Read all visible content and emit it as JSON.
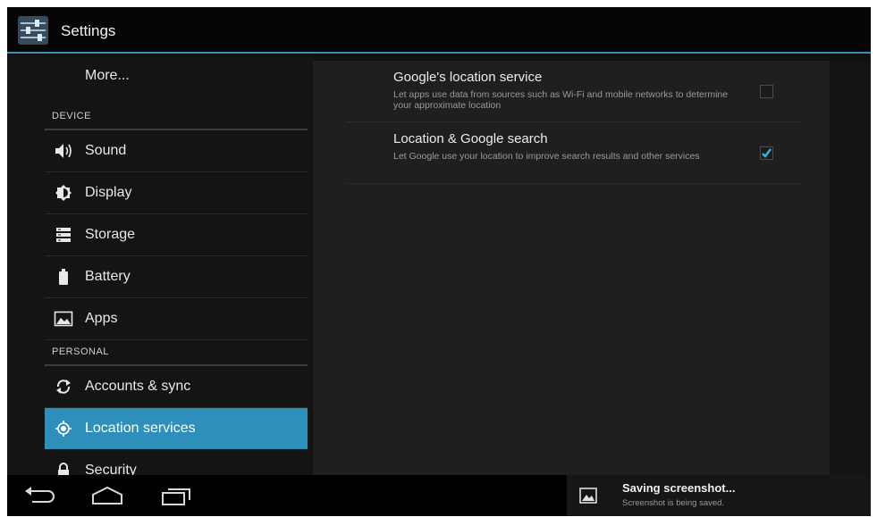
{
  "app": {
    "title": "Settings",
    "icon": "settings-sliders-icon",
    "accent_color": "#3a8fb5"
  },
  "sidebar": {
    "more_label": "More...",
    "device_header": "DEVICE",
    "device_items": [
      {
        "label": "Sound",
        "icon": "speaker-icon"
      },
      {
        "label": "Display",
        "icon": "brightness-icon"
      },
      {
        "label": "Storage",
        "icon": "storage-icon"
      },
      {
        "label": "Battery",
        "icon": "battery-icon"
      },
      {
        "label": "Apps",
        "icon": "apps-icon"
      }
    ],
    "personal_header": "PERSONAL",
    "personal_items": [
      {
        "label": "Accounts & sync",
        "icon": "sync-icon"
      },
      {
        "label": "Location services",
        "icon": "location-icon",
        "selected": true
      },
      {
        "label": "Security",
        "icon": "lock-icon"
      }
    ],
    "selected_color": "#2f8fbb"
  },
  "content": {
    "preferences": [
      {
        "title": "Google's location service",
        "summary": "Let apps use data from sources such as Wi-Fi and mobile networks to determine your approximate location",
        "checked": false
      },
      {
        "title": "Location & Google search",
        "summary": "Let Google use your location to improve search results and other services",
        "checked": true
      }
    ]
  },
  "system_bar": {
    "nav": [
      "back-icon",
      "home-icon",
      "recent-apps-icon"
    ],
    "notification": {
      "title": "Saving screenshot...",
      "text": "Screenshot is being saved.",
      "icon": "image-icon"
    }
  }
}
